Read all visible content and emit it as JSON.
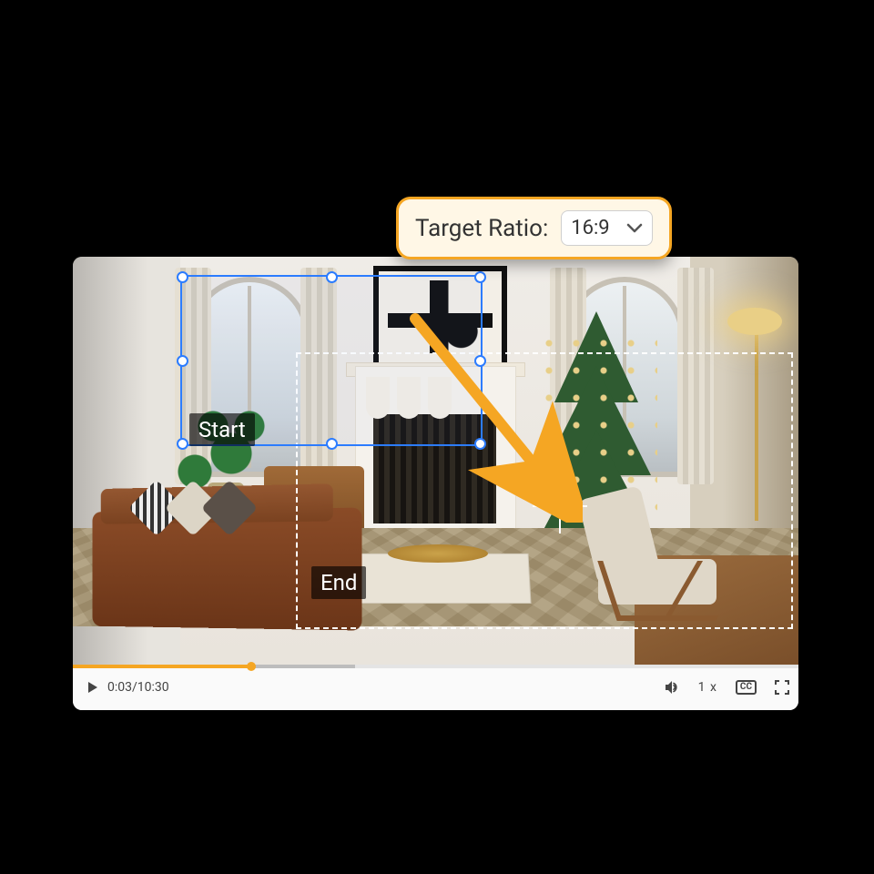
{
  "ratio": {
    "label": "Target Ratio:",
    "value": "16:9"
  },
  "overlay": {
    "start": "Start",
    "end": "End"
  },
  "player": {
    "current": "0:03",
    "duration": "10:30",
    "separator": " / ",
    "speed": "1 x",
    "cc": "CC"
  }
}
